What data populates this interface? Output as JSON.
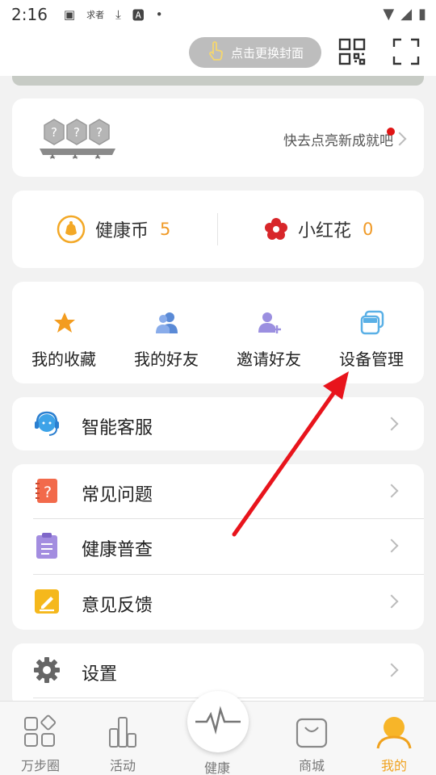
{
  "status_bar": {
    "time": "2:16",
    "notification_text": "求者"
  },
  "header": {
    "change_cover_label": "点击更换封面"
  },
  "achievements": {
    "badges": [
      "?",
      "?",
      "?"
    ],
    "prompt": "快去点亮新成就吧"
  },
  "rewards": {
    "coin_label": "健康币",
    "coin_value": "5",
    "flower_label": "小红花",
    "flower_value": "0"
  },
  "shortcuts": [
    {
      "label": "我的收藏",
      "icon": "star-icon"
    },
    {
      "label": "我的好友",
      "icon": "friends-icon"
    },
    {
      "label": "邀请好友",
      "icon": "invite-friend-icon"
    },
    {
      "label": "设备管理",
      "icon": "device-management-icon"
    }
  ],
  "menu": {
    "service": "智能客服",
    "faq": "常见问题",
    "health_check": "健康普查",
    "feedback": "意见反馈",
    "settings": "设置"
  },
  "tabs": [
    {
      "label": "万步圈",
      "active": false
    },
    {
      "label": "活动",
      "active": false
    },
    {
      "label": "健康",
      "active": false
    },
    {
      "label": "商城",
      "active": false
    },
    {
      "label": "我的",
      "active": true
    }
  ],
  "colors": {
    "accent": "#f0a21e",
    "badge_red": "#e01515",
    "coin_value": "#f09a27",
    "annotation_arrow": "#e8141c"
  }
}
